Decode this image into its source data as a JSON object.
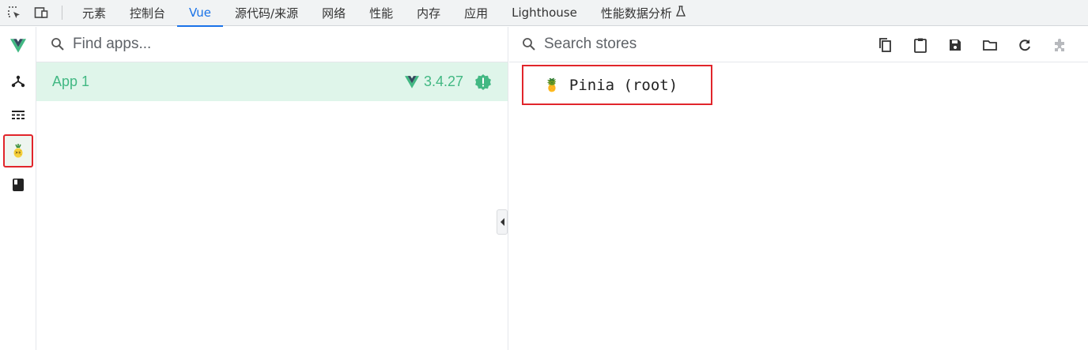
{
  "devtools": {
    "tabs": [
      {
        "label": "元素"
      },
      {
        "label": "控制台"
      },
      {
        "label": "Vue"
      },
      {
        "label": "源代码/来源"
      },
      {
        "label": "网络"
      },
      {
        "label": "性能"
      },
      {
        "label": "内存"
      },
      {
        "label": "应用"
      },
      {
        "label": "Lighthouse"
      },
      {
        "label": "性能数据分析"
      }
    ],
    "active_tab": "Vue",
    "toolbar_icons": [
      "inspect-element-icon",
      "device-toolbar-icon"
    ],
    "experimental_icon": "flask-icon"
  },
  "sidenav": {
    "items": [
      "vue-logo-icon",
      "components-tree-icon",
      "timeline-icon",
      "pinia-icon",
      "book-icon"
    ],
    "active": "pinia-icon"
  },
  "apps": {
    "search_placeholder": "Find apps...",
    "list": [
      {
        "name": "App 1",
        "version": "3.4.27",
        "status_icon": "warning-badge-icon"
      }
    ]
  },
  "stores": {
    "search_placeholder": "Search stores",
    "toolbar": [
      "copy-icon",
      "clipboard-icon",
      "save-icon",
      "folder-icon",
      "refresh-icon",
      "plugin-icon"
    ],
    "items": [
      {
        "emoji": "🍍",
        "label": "Pinia (root)"
      }
    ]
  },
  "colors": {
    "vue_green": "#42b883",
    "active_tab_blue": "#1a73e8",
    "highlight_red": "#e1252b",
    "selected_row_bg": "#dff5ea"
  }
}
